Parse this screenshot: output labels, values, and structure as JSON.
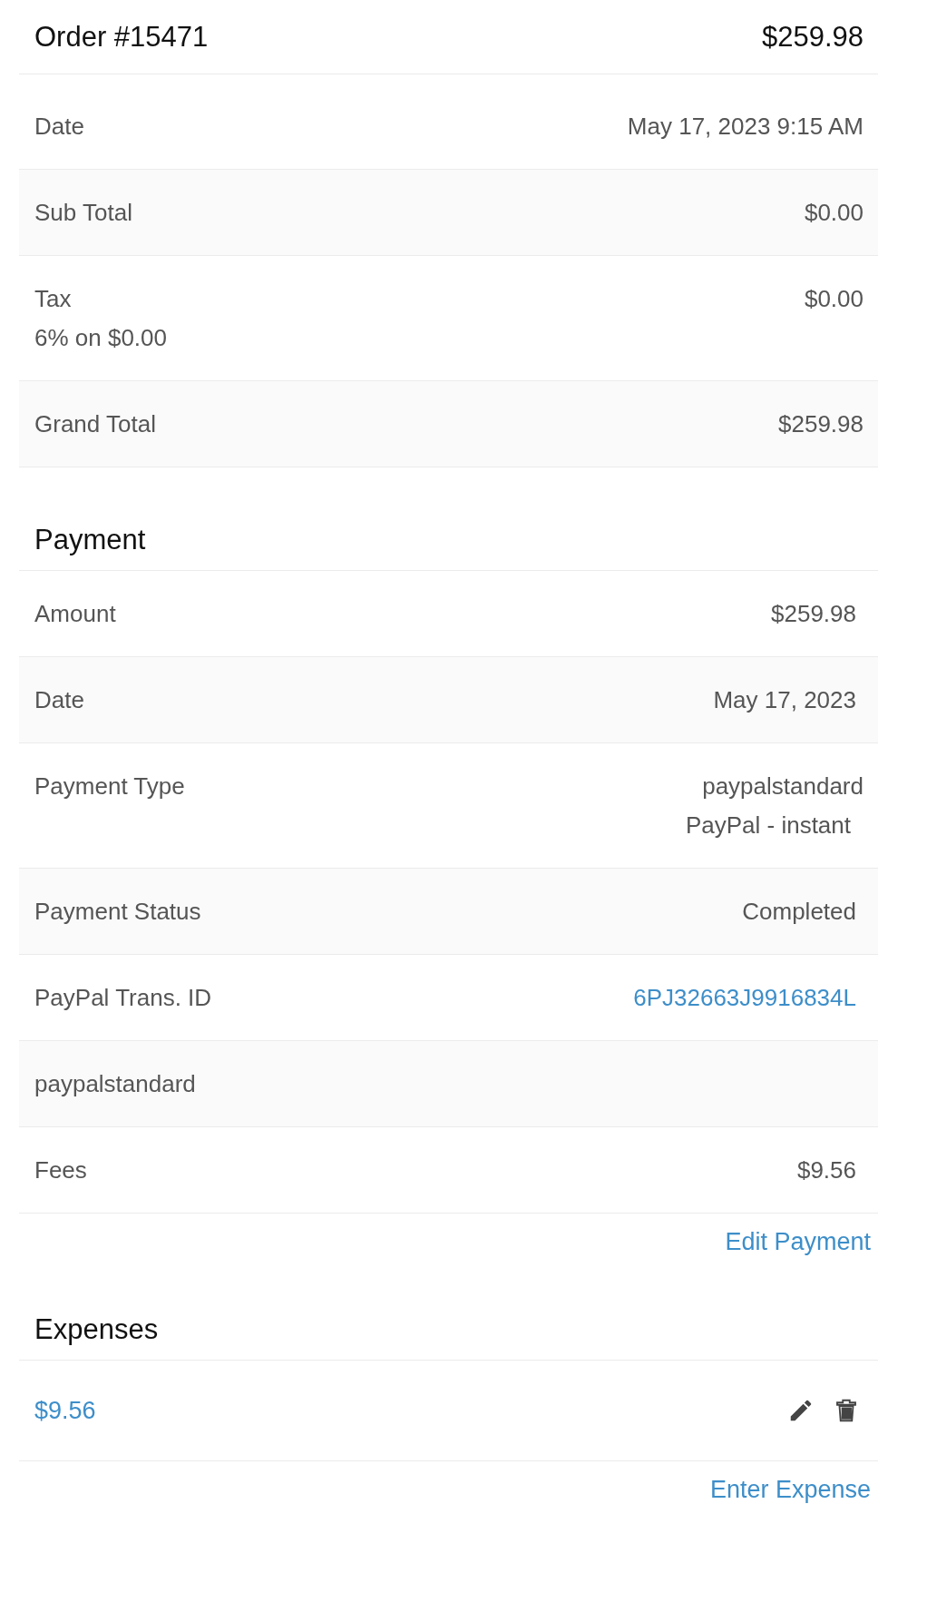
{
  "order": {
    "title": "Order #15471",
    "total": "$259.98"
  },
  "summary_rows": [
    {
      "label": "Date",
      "values": [
        "May 17, 2023 9:15 AM"
      ]
    },
    {
      "label": "Sub Total",
      "values": [
        "$0.00"
      ]
    },
    {
      "label": "Tax",
      "note": "6% on $0.00",
      "values": [
        "$0.00"
      ]
    },
    {
      "label": "Grand Total",
      "values": [
        "$259.98"
      ]
    }
  ],
  "payment": {
    "title": "Payment",
    "rows": [
      {
        "label": "Amount",
        "values": [
          "$259.98"
        ]
      },
      {
        "label": "Date",
        "values": [
          "May 17, 2023"
        ]
      },
      {
        "label": "Payment Type",
        "values": [
          "paypalstandard",
          "PayPal - instant"
        ]
      },
      {
        "label": "Payment Status",
        "values": [
          "Completed"
        ]
      },
      {
        "label": "PayPal Trans. ID",
        "values": [
          "6PJ32663J9916834L"
        ],
        "kind": "link"
      },
      {
        "label": "paypalstandard",
        "values": []
      },
      {
        "label": "Fees",
        "values": [
          "$9.56"
        ]
      }
    ],
    "action": "Edit Payment"
  },
  "expenses": {
    "title": "Expenses",
    "items": [
      {
        "amount": "$9.56"
      }
    ],
    "action": "Enter Expense"
  }
}
